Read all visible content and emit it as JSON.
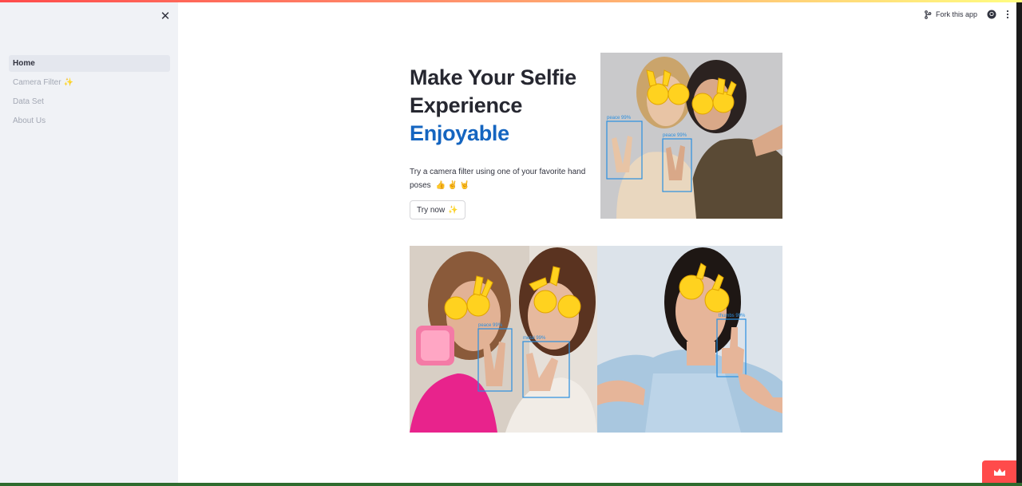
{
  "sidebar": {
    "close_icon": "close-icon",
    "items": [
      {
        "label": "Home",
        "active": true
      },
      {
        "label": "Camera Filter",
        "suffix": "✨"
      },
      {
        "label": "Data Set"
      },
      {
        "label": "About Us"
      }
    ]
  },
  "toolbar": {
    "fork_label": "Fork this app",
    "fork_icon": "fork-icon",
    "github_icon": "github-icon",
    "menu_icon": "more-vertical-icon"
  },
  "hero": {
    "title_line1": "Make Your Selfie",
    "title_line2": "Experience",
    "title_accent": "Enjoyable",
    "description": "Try a camera filter using one of your favorite hand poses",
    "description_emojis": "👍 ✌️ 🤘",
    "try_button": "Try now",
    "try_button_emoji": "✨"
  },
  "photos": {
    "detection_labels": [
      "peace 99%",
      "peace 99%",
      "peace 99%",
      "metal 99%",
      "thumbs 99%"
    ]
  },
  "colors": {
    "accent_blue": "#1565c0",
    "sidebar_bg": "#f0f2f6",
    "brand_red": "#ff4b4b"
  },
  "footer": {
    "crown_icon": "crown-icon"
  }
}
